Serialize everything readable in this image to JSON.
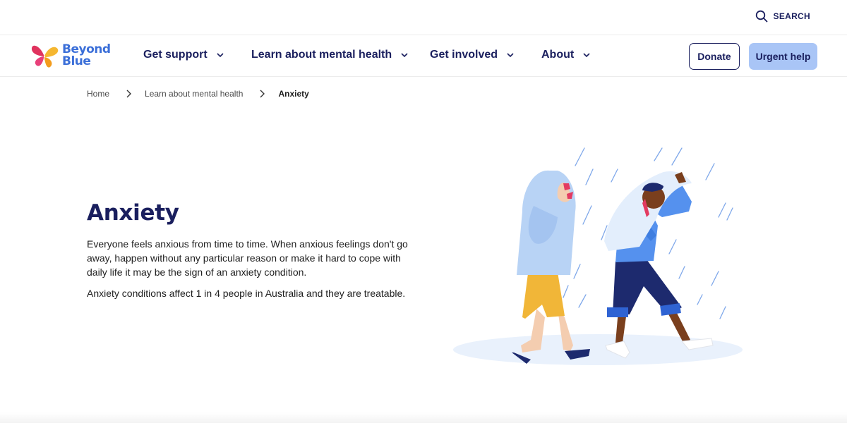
{
  "utility": {
    "search_label": "SEARCH"
  },
  "brand": {
    "line1": "Beyond",
    "line2": "Blue"
  },
  "nav": [
    {
      "label": "Get support"
    },
    {
      "label": "Learn about mental health"
    },
    {
      "label": "Get involved"
    },
    {
      "label": "About"
    }
  ],
  "actions": {
    "donate": "Donate",
    "urgent": "Urgent help"
  },
  "breadcrumb": {
    "home": "Home",
    "section": "Learn about mental health",
    "current": "Anxiety"
  },
  "hero": {
    "title": "Anxiety",
    "paragraph1": "Everyone feels anxious from time to time. When anxious feelings don't go away, happen without any particular reason or make it hard to cope with daily life it may be the sign of an anxiety condition.",
    "paragraph2": "Anxiety conditions affect 1 in 4 people in Australia and they are treatable."
  },
  "colors": {
    "brand_navy": "#1a1f5e",
    "brand_blue": "#3b6fd8",
    "urgent_bg": "#a9c5f6"
  },
  "icons": {
    "search": "search-icon",
    "chevron": "chevron-down-icon",
    "breadcrumb_sep": "chevron-right-icon",
    "logo": "butterfly-logo-icon"
  }
}
